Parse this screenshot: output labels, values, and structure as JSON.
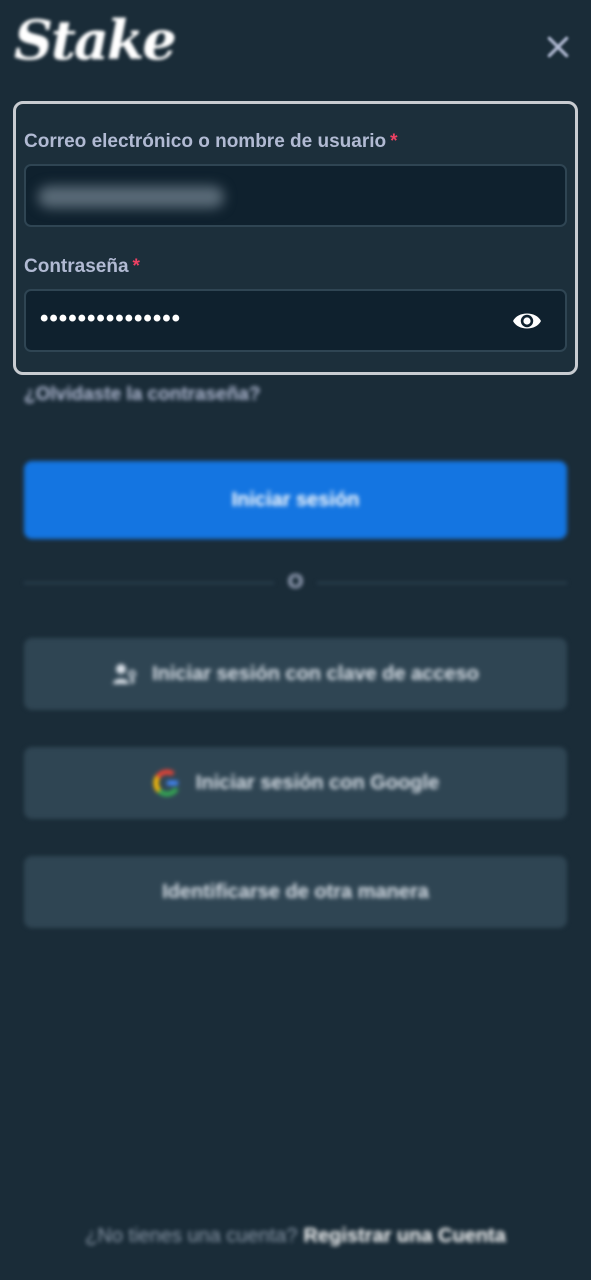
{
  "brand": {
    "logo_text": "Stake"
  },
  "header": {
    "close_icon": "close-icon"
  },
  "form": {
    "username_label": "Correo electrónico o nombre de usuario",
    "password_label": "Contraseña",
    "required_mark": "*",
    "password_value": "•••••••••••••••",
    "show_password_icon": "eye-icon"
  },
  "links": {
    "forgot_password": "¿Olvidaste la contraseña?"
  },
  "buttons": {
    "login": "Iniciar sesión",
    "divider_text": "O",
    "passkey": "Iniciar sesión con clave de acceso",
    "google": "Iniciar sesión con Google",
    "other": "Identificarse de otra manera"
  },
  "footer": {
    "prompt": "¿No tienes una cuenta?",
    "register": "Registrar una Cuenta"
  },
  "colors": {
    "background": "#1a2c38",
    "input_bg": "#0f212e",
    "primary": "#1475e1",
    "secondary": "#2f4553",
    "required": "#ed4163"
  }
}
